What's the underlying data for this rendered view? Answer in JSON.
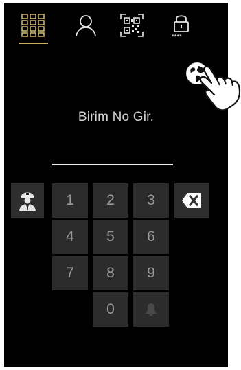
{
  "top_tabs": [
    {
      "name": "keypad",
      "icon": "keypad-grid-icon",
      "active": true
    },
    {
      "name": "contacts",
      "icon": "user-icon",
      "active": false
    },
    {
      "name": "qr-code",
      "icon": "qr-code-icon",
      "active": false
    },
    {
      "name": "password",
      "icon": "lock-password-icon",
      "active": false
    }
  ],
  "accent_color": "#c9b36a",
  "language_button": {
    "icon": "globe-icon"
  },
  "pointer_hint": {
    "icon": "pointing-hand-icon"
  },
  "prompt": {
    "text": "Birim No Gir."
  },
  "keypad": {
    "keys": [
      "1",
      "2",
      "3",
      "4",
      "5",
      "6",
      "7",
      "8",
      "9",
      "0"
    ],
    "concierge_icon": "concierge-icon",
    "backspace_icon": "backspace-icon",
    "bell_icon": "bell-icon"
  }
}
